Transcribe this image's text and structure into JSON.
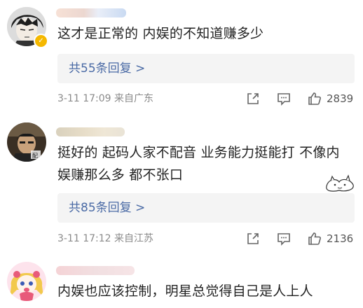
{
  "icons": {
    "share": "share-icon",
    "comment": "comment-icon",
    "like": "thumbs-up-icon"
  },
  "colors": {
    "link": "#4a6aa5",
    "meta": "#8a8a8a",
    "text": "#222222",
    "reply_bg": "#f4f4f4",
    "badge": "#f5b800"
  },
  "comments": [
    {
      "text": "这才是正常的 内娱的不知道赚多少",
      "replies_label": "共55条回复 >",
      "meta": "3-11 17:09  来自广东",
      "likes": "2839"
    },
    {
      "text": "挺好的 起码人家不配音 业务能力挺能打 不像内娱赚那么多 都不张口",
      "replies_label": "共85条回复 >",
      "meta": "3-11 17:12  来自江苏",
      "likes": "2136"
    },
    {
      "text": "内娱也应该控制，明星总觉得自己是人上人"
    }
  ]
}
